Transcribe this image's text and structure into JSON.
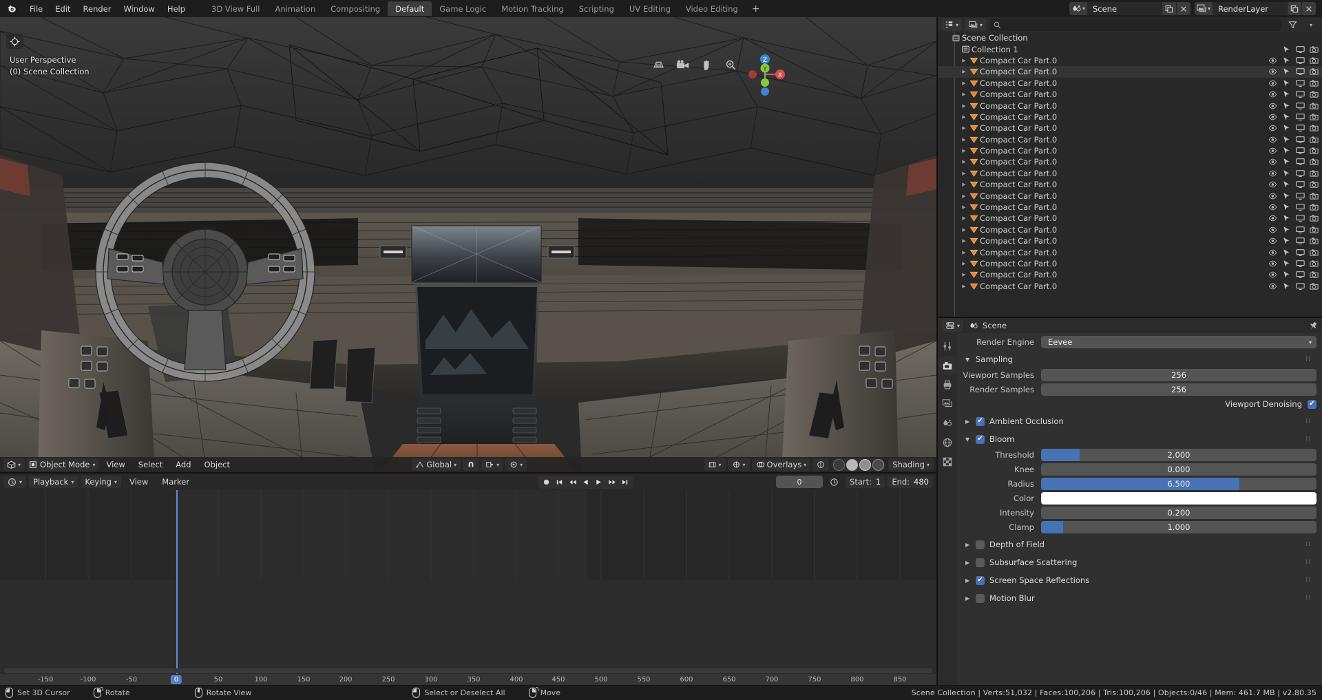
{
  "topbar": {
    "logo_icon": "blender-logo-icon",
    "menus": [
      "File",
      "Edit",
      "Render",
      "Window",
      "Help"
    ],
    "workspaces": [
      {
        "label": "3D View Full",
        "active": false
      },
      {
        "label": "Animation",
        "active": false
      },
      {
        "label": "Compositing",
        "active": false
      },
      {
        "label": "Default",
        "active": true
      },
      {
        "label": "Game Logic",
        "active": false
      },
      {
        "label": "Motion Tracking",
        "active": false
      },
      {
        "label": "Scripting",
        "active": false
      },
      {
        "label": "UV Editing",
        "active": false
      },
      {
        "label": "Video Editing",
        "active": false
      },
      {
        "label": "+",
        "active": false
      }
    ],
    "scene_block": {
      "icon": "scene-icon",
      "name": "Scene",
      "copy_icon": "new-copy-icon",
      "close_icon": "x-icon"
    },
    "viewlayer_block": {
      "icon": "viewlayer-icon",
      "name": "RenderLayer",
      "copy_icon": "new-copy-icon",
      "close_icon": "x-icon"
    }
  },
  "viewport": {
    "perspective_label": "User Perspective",
    "collection_label": "(0) Scene Collection",
    "tool_icon": "cursor-tool-icon",
    "nav_icons": [
      "grid-toggle-icon",
      "camera-view-icon",
      "pan-hand-icon",
      "zoom-magnifier-icon"
    ],
    "gizmo_axes": [
      "Z",
      "Y",
      "X"
    ],
    "header": {
      "editor_icon": "editor-type-3dview-icon",
      "mode": "Object Mode",
      "menus": [
        "View",
        "Select",
        "Add",
        "Object"
      ],
      "transform_orientation": "Global",
      "snap_icon": "magnet-icon",
      "proportional_icon": "proportional-edit-icon",
      "pivot_icon": "pivot-point-icon",
      "overlays_label": "Overlays",
      "shading_label": "Shading",
      "visibility_icon": "eye-visibility-icon",
      "gizmo_icon": "gizmo-icon",
      "shading_modes": [
        "wireframe",
        "solid",
        "lookdev",
        "rendered"
      ]
    }
  },
  "timeline": {
    "editor_icon": "timeline-editor-icon",
    "menus": [
      "Playback",
      "Keying",
      "View",
      "Marker"
    ],
    "transport_buttons": [
      "record-icon",
      "jump-start-icon",
      "prev-keyframe-icon",
      "play-reverse-icon",
      "play-icon",
      "next-keyframe-icon",
      "jump-end-icon"
    ],
    "current_frame": "0",
    "sync_icon": "sync-clock-icon",
    "start_label": "Start:",
    "start_value": "1",
    "end_label": "End:",
    "end_value": "480",
    "ruler_ticks": [
      "-150",
      "-100",
      "-50",
      "0",
      "50",
      "100",
      "150",
      "200",
      "250",
      "300",
      "350",
      "400",
      "450",
      "500",
      "550",
      "600",
      "650",
      "700",
      "750",
      "800",
      "850"
    ],
    "playhead_frame": "0"
  },
  "outliner": {
    "display_mode_icon": "outliner-display-mode-icon",
    "filter_id_icon": "filter-id-icon",
    "search_placeholder": "",
    "search_icon": "search-icon",
    "filter_icon": "funnel-filter-icon",
    "root": {
      "label": "Scene Collection",
      "icon": "scene-collection-icon"
    },
    "collection": {
      "label": "Collection 1",
      "icon": "collection-icon"
    },
    "object_icon": "mesh-object-icon",
    "row_icons": [
      "eye-icon",
      "cursor-select-icon",
      "monitor-screen-icon",
      "camera-render-icon"
    ],
    "objects": [
      {
        "label": "Compact Car Part.0",
        "selected": false
      },
      {
        "label": "Compact Car Part.0",
        "selected": true
      },
      {
        "label": "Compact Car Part.0",
        "selected": false
      },
      {
        "label": "Compact Car Part.0",
        "selected": false
      },
      {
        "label": "Compact Car Part.0",
        "selected": false
      },
      {
        "label": "Compact Car Part.0",
        "selected": false
      },
      {
        "label": "Compact Car Part.0",
        "selected": false
      },
      {
        "label": "Compact Car Part.0",
        "selected": false
      },
      {
        "label": "Compact Car Part.0",
        "selected": false
      },
      {
        "label": "Compact Car Part.0",
        "selected": false
      },
      {
        "label": "Compact Car Part.0",
        "selected": false
      },
      {
        "label": "Compact Car Part.0",
        "selected": false
      },
      {
        "label": "Compact Car Part.0",
        "selected": false
      },
      {
        "label": "Compact Car Part.0",
        "selected": false
      },
      {
        "label": "Compact Car Part.0",
        "selected": false
      },
      {
        "label": "Compact Car Part.0",
        "selected": false
      },
      {
        "label": "Compact Car Part.0",
        "selected": false
      },
      {
        "label": "Compact Car Part.0",
        "selected": false
      },
      {
        "label": "Compact Car Part.0",
        "selected": false
      },
      {
        "label": "Compact Car Part.0",
        "selected": false
      },
      {
        "label": "Compact Car Part.0",
        "selected": false
      }
    ]
  },
  "properties": {
    "header": {
      "editor_icon": "properties-editor-icon",
      "breadcrumb_icon": "scene-icon",
      "breadcrumb": "Scene",
      "pin_icon": "pin-icon"
    },
    "tabs": [
      {
        "name": "tool-tab",
        "icon": "tool-icon",
        "active": false
      },
      {
        "name": "render-tab",
        "icon": "render-camera-icon",
        "active": true
      },
      {
        "name": "output-tab",
        "icon": "printer-output-icon",
        "active": false
      },
      {
        "name": "viewlayer-tab",
        "icon": "viewlayer-images-icon",
        "active": false
      },
      {
        "name": "scene-tab",
        "icon": "scene-cone-icon",
        "active": false
      },
      {
        "name": "world-tab",
        "icon": "world-globe-icon",
        "active": false
      },
      {
        "name": "texture-tab",
        "icon": "texture-checker-icon",
        "active": false
      }
    ],
    "render_engine_label": "Render Engine",
    "render_engine_value": "Eevee",
    "sections": [
      {
        "title": "Sampling",
        "open": true,
        "checkbox": null
      },
      {
        "title": "Ambient Occlusion",
        "open": false,
        "checkbox": true
      },
      {
        "title": "Bloom",
        "open": true,
        "checkbox": true
      },
      {
        "title": "Depth of Field",
        "open": false,
        "checkbox": false
      },
      {
        "title": "Subsurface Scattering",
        "open": false,
        "checkbox": false
      },
      {
        "title": "Screen Space Reflections",
        "open": false,
        "checkbox": true
      },
      {
        "title": "Motion Blur",
        "open": false,
        "checkbox": false
      }
    ],
    "sampling": {
      "viewport_samples_label": "Viewport Samples",
      "viewport_samples_value": "256",
      "render_samples_label": "Render Samples",
      "render_samples_value": "256",
      "viewport_denoising_label": "Viewport Denoising",
      "viewport_denoising_checked": true
    },
    "bloom": {
      "threshold_label": "Threshold",
      "threshold_value": "2.000",
      "threshold_fill": 14,
      "knee_label": "Knee",
      "knee_value": "0.000",
      "knee_fill": 0,
      "radius_label": "Radius",
      "radius_value": "6.500",
      "radius_fill": 72,
      "color_label": "Color",
      "color_value": "#ffffff",
      "intensity_label": "Intensity",
      "intensity_value": "0.200",
      "intensity_fill": 0,
      "clamp_label": "Clamp",
      "clamp_value": "1.000",
      "clamp_fill": 8
    }
  },
  "statusbar": {
    "hints": [
      {
        "icon": "mouse-left-icon",
        "label": "Set 3D Cursor"
      },
      {
        "icon": "mouse-right-drag-icon",
        "label": "Rotate"
      },
      {
        "icon": "mouse-middle-icon",
        "label": "Rotate View"
      },
      {
        "icon": "mouse-left-icon",
        "label": "Select or Deselect All"
      },
      {
        "icon": "mouse-right-drag-icon",
        "label": "Move"
      }
    ],
    "stats": "Scene Collection | Verts:51,032 | Faces:100,206 | Tris:100,206 | Objects:0/46 | Mem: 461.7 MB | v2.80.35"
  },
  "colors": {
    "accent_blue": "#4772b3",
    "header_bg": "#1d1d1d",
    "panel_bg": "#303030",
    "outliner_bg": "#282828",
    "field_bg": "#545454",
    "orange_mesh": "#e08a3c"
  }
}
